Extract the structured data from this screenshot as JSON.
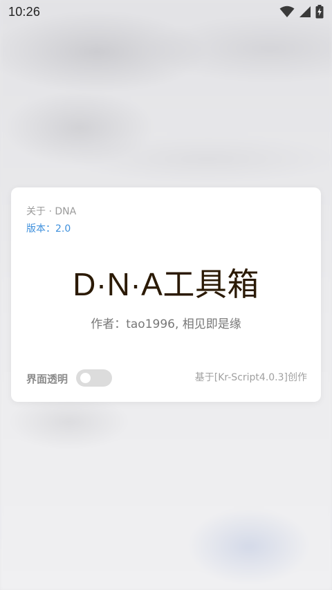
{
  "status_bar": {
    "time": "10:26",
    "icons": [
      "wifi-icon",
      "cellular-signal-icon",
      "battery-charging-icon"
    ]
  },
  "dialog": {
    "about_title": "关于 · DNA",
    "version": "版本：2.0",
    "app_title": "D·N·A工具箱",
    "author": "作者：tao1996, 相见即是缘",
    "toggle_label": "界面透明",
    "toggle_on": false,
    "built_with": "基于[Kr-Script4.0.3]创作"
  },
  "colors": {
    "accent_blue": "#3d8fdc",
    "title_dark_brown": "#2b1a05",
    "card_bg": "#ffffff",
    "toggle_off": "#dcdcdc"
  }
}
